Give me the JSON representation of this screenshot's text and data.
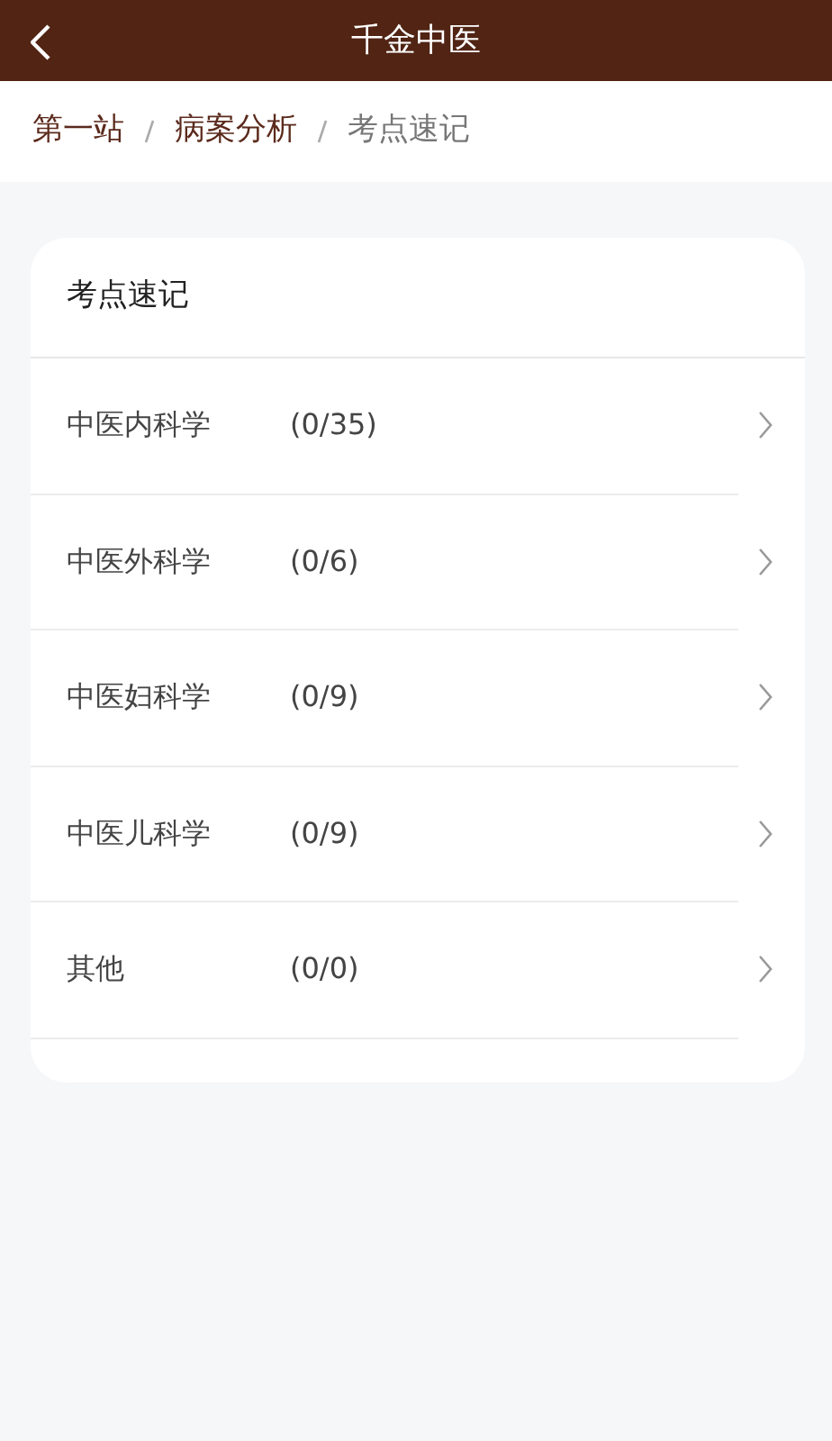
{
  "app_bar": {
    "title": "千金中医"
  },
  "breadcrumb": [
    {
      "label": "第一站",
      "current": false
    },
    {
      "label": "病案分析",
      "current": false
    },
    {
      "label": "考点速记",
      "current": true
    }
  ],
  "card": {
    "title": "考点速记",
    "items": [
      {
        "name": "中医内科学",
        "count": "(0/35)"
      },
      {
        "name": "中医外科学",
        "count": "(0/6)"
      },
      {
        "name": "中医妇科学",
        "count": "(0/9)"
      },
      {
        "name": "中医儿科学",
        "count": "(0/9)"
      },
      {
        "name": "其他",
        "count": "(0/0)"
      }
    ]
  }
}
